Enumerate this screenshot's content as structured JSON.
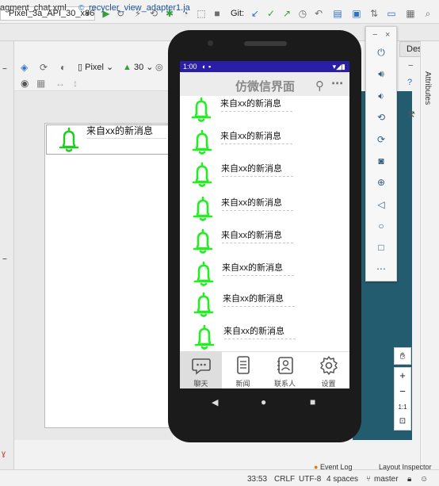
{
  "toolbar": {
    "device": "Pixel_3a_API_30_x86",
    "git_label": "Git:"
  },
  "tabs": [
    {
      "label": "agment_chat.xml"
    },
    {
      "label": "recycler_view_adapter1.ja"
    }
  ],
  "design_toolbar": {
    "pixel_label": "Pixel",
    "api_label": "30"
  },
  "design_tab": "Design",
  "attributes_label": "Attributes",
  "preview": {
    "message": "来自xx的新消息"
  },
  "phone": {
    "status_time": "1:00",
    "app_title": "仿微信界面",
    "messages": [
      "来自xx的新消息",
      "来自xx的新消息",
      "来自xx的新消息",
      "来自xx的新消息",
      "来自xx的新消息",
      "来自xx的新消息",
      "来自xx的新消息",
      "来自xx的新消息"
    ],
    "nav": [
      {
        "label": "聊天",
        "icon": "chat-icon",
        "selected": true
      },
      {
        "label": "新闻",
        "icon": "news-icon",
        "selected": false
      },
      {
        "label": "联系人",
        "icon": "contacts-icon",
        "selected": false
      },
      {
        "label": "设置",
        "icon": "settings-icon",
        "selected": false
      }
    ]
  },
  "colors": {
    "bell": "#22ee22",
    "statusbar": "#2b1ea6",
    "emulator_bg": "#245c6f"
  },
  "zoom": {
    "ratio": "1:1"
  },
  "footer": {
    "event_log": "Event Log",
    "layout_inspector": "Layout Inspector",
    "position": "33:53",
    "line_sep": "CRLF",
    "encoding": "UTF-8",
    "indent": "4 spaces",
    "branch": "master"
  }
}
